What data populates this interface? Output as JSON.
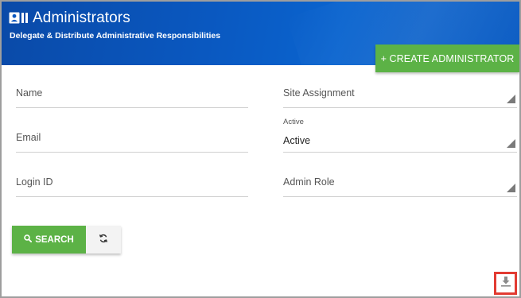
{
  "header": {
    "title": "Administrators",
    "subtitle": "Delegate & Distribute Administrative Responsibilities",
    "title_icon": "id-card-icon"
  },
  "actions": {
    "create_label": "+ CREATE ADMINISTRATOR"
  },
  "form": {
    "name_label": "Name",
    "email_label": "Email",
    "login_label": "Login ID",
    "site_label": "Site Assignment",
    "active_small_label": "Active",
    "active_value": "Active",
    "admin_role_label": "Admin Role"
  },
  "buttons": {
    "search_label": "SEARCH",
    "search_icon": "search-icon",
    "reset_icon": "refresh-icon",
    "download_icon": "download-icon"
  },
  "colors": {
    "header_blue": "#0a58c0",
    "accent_green": "#5cb246",
    "highlight_red": "#e23b32"
  }
}
